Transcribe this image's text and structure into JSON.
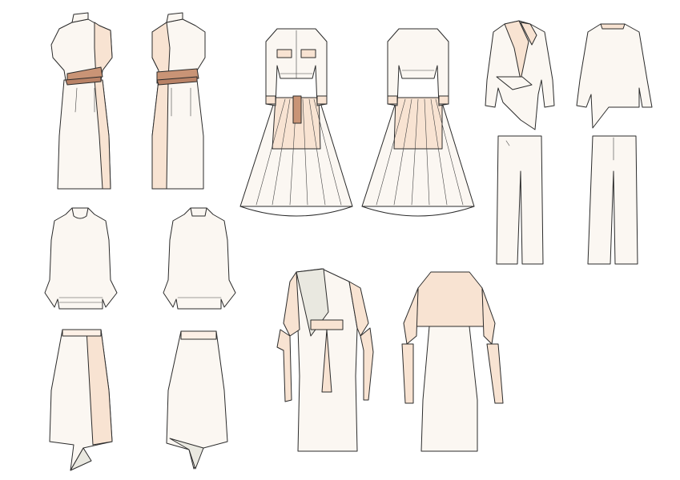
{
  "board": {
    "background": "#ffffff",
    "palette": {
      "fabric_cream": "#fbf7f2",
      "fabric_peach": "#f8e3d2",
      "fabric_peach_light": "#fdf0e6",
      "belt_tan": "#c99476",
      "lining_grey": "#e9e8e0",
      "outline": "#2b2b2b"
    },
    "items": [
      {
        "name": "wrap-belt-dress",
        "views": [
          "front",
          "back"
        ],
        "icon": "dress-icon"
      },
      {
        "name": "cropped-jacket-pleated-skirt",
        "views": [
          "front",
          "back"
        ],
        "icon": "jacket-skirt-icon"
      },
      {
        "name": "asymmetric-blazer-wide-trousers",
        "views": [
          "front",
          "back"
        ],
        "icon": "blazer-trousers-icon"
      },
      {
        "name": "high-neck-top",
        "views": [
          "front",
          "back"
        ],
        "icon": "top-icon"
      },
      {
        "name": "asymmetric-midi-skirt",
        "views": [
          "front",
          "back"
        ],
        "icon": "skirt-icon"
      },
      {
        "name": "belted-wrap-coat-dress",
        "views": [
          "front",
          "back"
        ],
        "icon": "coat-dress-icon"
      }
    ]
  }
}
